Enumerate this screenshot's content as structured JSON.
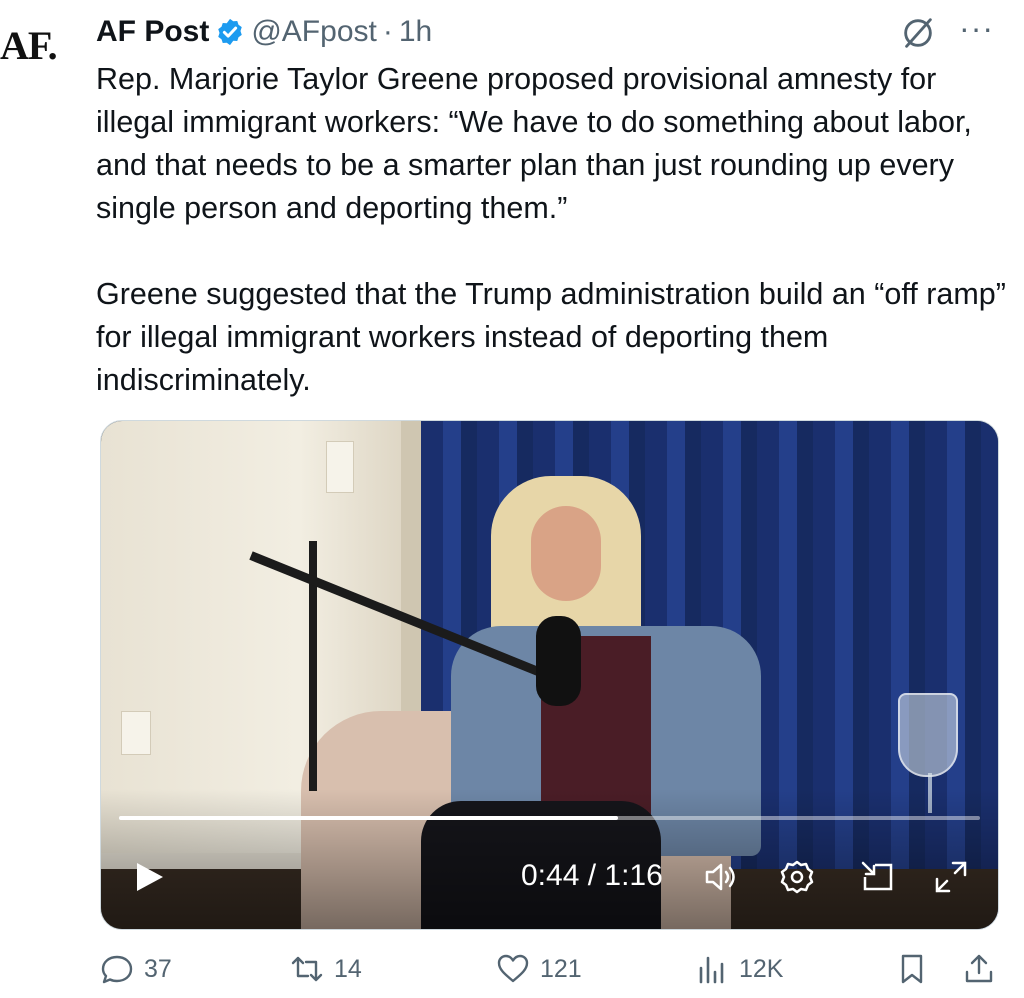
{
  "post": {
    "avatar_text": "AF.",
    "display_name": "AF Post",
    "handle": "@AFpost",
    "separator": "·",
    "time": "1h",
    "more_label": "···",
    "paragraphs": [
      "Rep. Marjorie Taylor Greene proposed provisional amnesty for illegal immigrant workers: “We have to do something about labor, and that needs to be a smarter plan than just rounding up every single person and deporting them.”",
      "Greene suggested that the Trump administration build an “off ramp” for illegal immigrant workers instead of deporting them indiscriminately."
    ]
  },
  "video": {
    "timecode": "0:44 / 1:16",
    "progress": 0.579
  },
  "actions": {
    "replies": "37",
    "reposts": "14",
    "likes": "121",
    "views": "12K"
  },
  "colors": {
    "verified": "#1d9bf0",
    "muted": "#536471",
    "text": "#0f1419"
  },
  "icons": [
    "verified-badge-icon",
    "grok-icon",
    "more-icon",
    "play-icon",
    "volume-icon",
    "settings-icon",
    "pip-icon",
    "fullscreen-icon",
    "reply-icon",
    "repost-icon",
    "like-icon",
    "views-icon",
    "bookmark-icon",
    "share-icon"
  ]
}
